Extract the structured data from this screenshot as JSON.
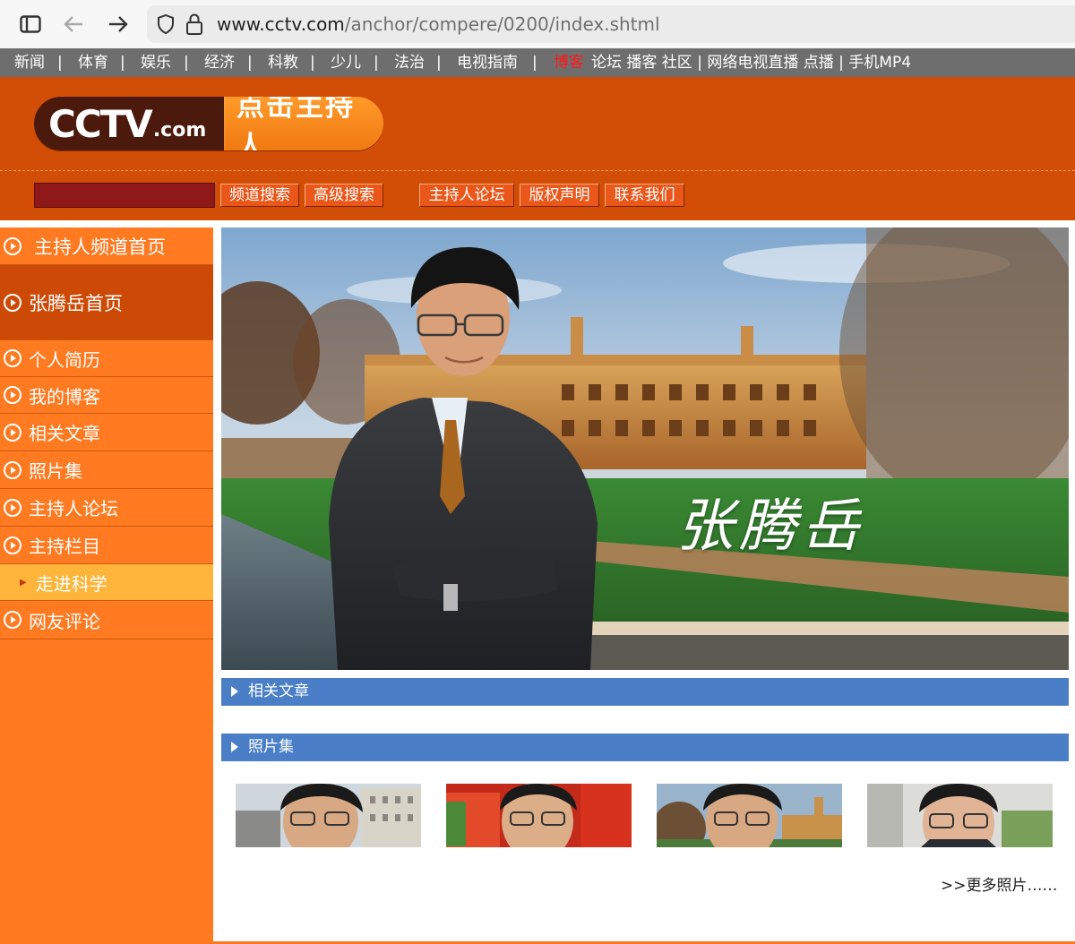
{
  "browser": {
    "url_domain": "www.cctv.com",
    "url_path": "/anchor/compere/0200/index.shtml"
  },
  "topnav": {
    "items": [
      "新闻",
      "体育",
      "娱乐",
      "经济",
      "科教",
      "少儿",
      "法治",
      "电视指南"
    ],
    "separator": "|",
    "hot": "博客",
    "tail": "论坛 播客 社区 | 网络电视直播 点播 | 手机MP4"
  },
  "header": {
    "logo_text": "CCTV",
    "logo_suffix": ".com",
    "logo_subtitle": "点击主持人",
    "search_button": "频道搜索",
    "advanced_button": "高级搜索",
    "links": [
      "主持人论坛",
      "版权声明",
      "联系我们"
    ]
  },
  "sidebar": {
    "items": [
      {
        "label": "主持人频道首页"
      },
      {
        "label": "张腾岳首页"
      },
      {
        "label": "个人简历"
      },
      {
        "label": "我的博客"
      },
      {
        "label": "相关文章"
      },
      {
        "label": "照片集"
      },
      {
        "label": "主持人论坛"
      },
      {
        "label": "主持栏目"
      },
      {
        "label": "走进科学"
      },
      {
        "label": "网友评论"
      }
    ]
  },
  "hero": {
    "signature": "张腾岳"
  },
  "sections": {
    "articles": "相关文章",
    "photos": "照片集"
  },
  "more_photos": ">>更多照片……",
  "colors": {
    "header_orange": "#d24e07",
    "sidebar_orange": "#ff7a21",
    "section_blue": "#4a7fc8",
    "nav_gray": "#6e6e6e"
  }
}
